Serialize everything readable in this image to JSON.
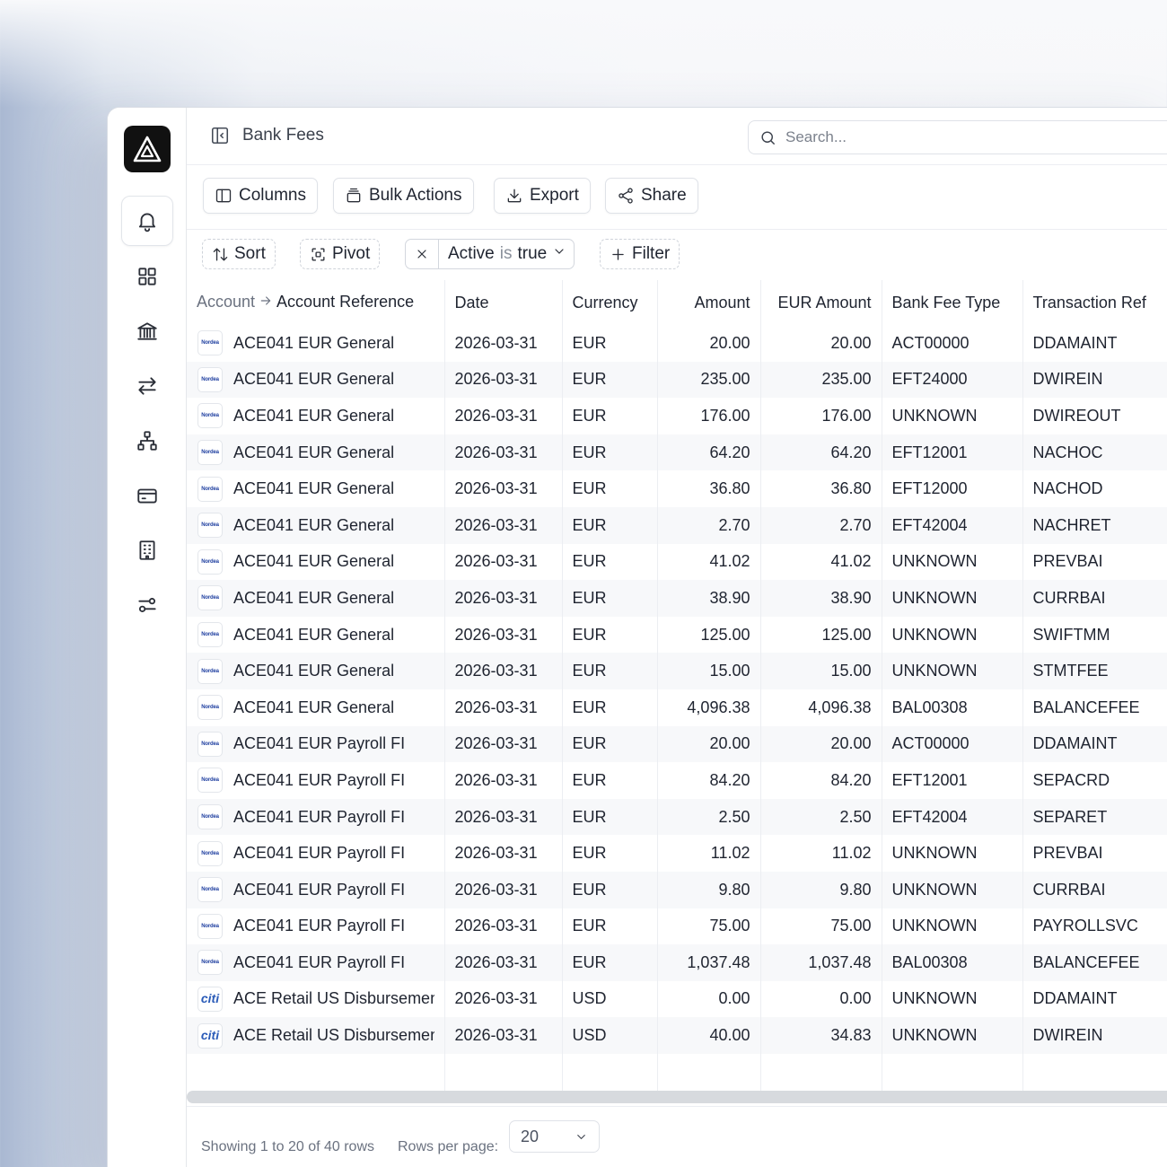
{
  "header": {
    "title": "Bank Fees",
    "search_placeholder": "Search..."
  },
  "toolbar": {
    "columns_label": "Columns",
    "bulk_actions_label": "Bulk Actions",
    "export_label": "Export",
    "share_label": "Share"
  },
  "filterbar": {
    "sort_label": "Sort",
    "pivot_label": "Pivot",
    "active_filter": {
      "field": "Active",
      "operator": "is",
      "value": "true"
    },
    "filter_label": "Filter"
  },
  "table": {
    "headers": {
      "account": "Account",
      "account_reference": "Account Reference",
      "date": "Date",
      "currency": "Currency",
      "amount": "Amount",
      "eur_amount": "EUR Amount",
      "bank_fee_type": "Bank Fee Type",
      "transaction_ref": "Transaction Ref"
    },
    "rows": [
      {
        "bank": "Nordea",
        "account": "ACE041 EUR General",
        "date": "2026-03-31",
        "currency": "EUR",
        "amount": "20.00",
        "eur_amount": "20.00",
        "fee_type": "ACT00000",
        "tx_ref": "DDAMAINT"
      },
      {
        "bank": "Nordea",
        "account": "ACE041 EUR General",
        "date": "2026-03-31",
        "currency": "EUR",
        "amount": "235.00",
        "eur_amount": "235.00",
        "fee_type": "EFT24000",
        "tx_ref": "DWIREIN"
      },
      {
        "bank": "Nordea",
        "account": "ACE041 EUR General",
        "date": "2026-03-31",
        "currency": "EUR",
        "amount": "176.00",
        "eur_amount": "176.00",
        "fee_type": "UNKNOWN",
        "tx_ref": "DWIREOUT"
      },
      {
        "bank": "Nordea",
        "account": "ACE041 EUR General",
        "date": "2026-03-31",
        "currency": "EUR",
        "amount": "64.20",
        "eur_amount": "64.20",
        "fee_type": "EFT12001",
        "tx_ref": "NACHOC"
      },
      {
        "bank": "Nordea",
        "account": "ACE041 EUR General",
        "date": "2026-03-31",
        "currency": "EUR",
        "amount": "36.80",
        "eur_amount": "36.80",
        "fee_type": "EFT12000",
        "tx_ref": "NACHOD"
      },
      {
        "bank": "Nordea",
        "account": "ACE041 EUR General",
        "date": "2026-03-31",
        "currency": "EUR",
        "amount": "2.70",
        "eur_amount": "2.70",
        "fee_type": "EFT42004",
        "tx_ref": "NACHRET"
      },
      {
        "bank": "Nordea",
        "account": "ACE041 EUR General",
        "date": "2026-03-31",
        "currency": "EUR",
        "amount": "41.02",
        "eur_amount": "41.02",
        "fee_type": "UNKNOWN",
        "tx_ref": "PREVBAI"
      },
      {
        "bank": "Nordea",
        "account": "ACE041 EUR General",
        "date": "2026-03-31",
        "currency": "EUR",
        "amount": "38.90",
        "eur_amount": "38.90",
        "fee_type": "UNKNOWN",
        "tx_ref": "CURRBAI"
      },
      {
        "bank": "Nordea",
        "account": "ACE041 EUR General",
        "date": "2026-03-31",
        "currency": "EUR",
        "amount": "125.00",
        "eur_amount": "125.00",
        "fee_type": "UNKNOWN",
        "tx_ref": "SWIFTMM"
      },
      {
        "bank": "Nordea",
        "account": "ACE041 EUR General",
        "date": "2026-03-31",
        "currency": "EUR",
        "amount": "15.00",
        "eur_amount": "15.00",
        "fee_type": "UNKNOWN",
        "tx_ref": "STMTFEE"
      },
      {
        "bank": "Nordea",
        "account": "ACE041 EUR General",
        "date": "2026-03-31",
        "currency": "EUR",
        "amount": "4,096.38",
        "eur_amount": "4,096.38",
        "fee_type": "BAL00308",
        "tx_ref": "BALANCEFEE"
      },
      {
        "bank": "Nordea",
        "account": "ACE041 EUR Payroll FI",
        "date": "2026-03-31",
        "currency": "EUR",
        "amount": "20.00",
        "eur_amount": "20.00",
        "fee_type": "ACT00000",
        "tx_ref": "DDAMAINT"
      },
      {
        "bank": "Nordea",
        "account": "ACE041 EUR Payroll FI",
        "date": "2026-03-31",
        "currency": "EUR",
        "amount": "84.20",
        "eur_amount": "84.20",
        "fee_type": "EFT12001",
        "tx_ref": "SEPACRD"
      },
      {
        "bank": "Nordea",
        "account": "ACE041 EUR Payroll FI",
        "date": "2026-03-31",
        "currency": "EUR",
        "amount": "2.50",
        "eur_amount": "2.50",
        "fee_type": "EFT42004",
        "tx_ref": "SEPARET"
      },
      {
        "bank": "Nordea",
        "account": "ACE041 EUR Payroll FI",
        "date": "2026-03-31",
        "currency": "EUR",
        "amount": "11.02",
        "eur_amount": "11.02",
        "fee_type": "UNKNOWN",
        "tx_ref": "PREVBAI"
      },
      {
        "bank": "Nordea",
        "account": "ACE041 EUR Payroll FI",
        "date": "2026-03-31",
        "currency": "EUR",
        "amount": "9.80",
        "eur_amount": "9.80",
        "fee_type": "UNKNOWN",
        "tx_ref": "CURRBAI"
      },
      {
        "bank": "Nordea",
        "account": "ACE041 EUR Payroll FI",
        "date": "2026-03-31",
        "currency": "EUR",
        "amount": "75.00",
        "eur_amount": "75.00",
        "fee_type": "UNKNOWN",
        "tx_ref": "PAYROLLSVC"
      },
      {
        "bank": "Nordea",
        "account": "ACE041 EUR Payroll FI",
        "date": "2026-03-31",
        "currency": "EUR",
        "amount": "1,037.48",
        "eur_amount": "1,037.48",
        "fee_type": "BAL00308",
        "tx_ref": "BALANCEFEE"
      },
      {
        "bank": "citi",
        "account": "ACE Retail US Disbursement",
        "date": "2026-03-31",
        "currency": "USD",
        "amount": "0.00",
        "eur_amount": "0.00",
        "fee_type": "UNKNOWN",
        "tx_ref": "DDAMAINT"
      },
      {
        "bank": "citi",
        "account": "ACE Retail US Disbursement",
        "date": "2026-03-31",
        "currency": "USD",
        "amount": "40.00",
        "eur_amount": "34.83",
        "fee_type": "UNKNOWN",
        "tx_ref": "DWIREIN"
      }
    ]
  },
  "footer": {
    "showing_text": "Showing 1 to 20 of 40 rows",
    "rows_per_page_label": "Rows per page:",
    "rows_per_page_value": "20"
  },
  "icons": {
    "logo": "delta-logo-icon",
    "nav": [
      "bell-icon",
      "grid-icon",
      "bank-icon",
      "transfer-icon",
      "hierarchy-icon",
      "card-icon",
      "building-icon",
      "settings-sliders-icon"
    ]
  }
}
